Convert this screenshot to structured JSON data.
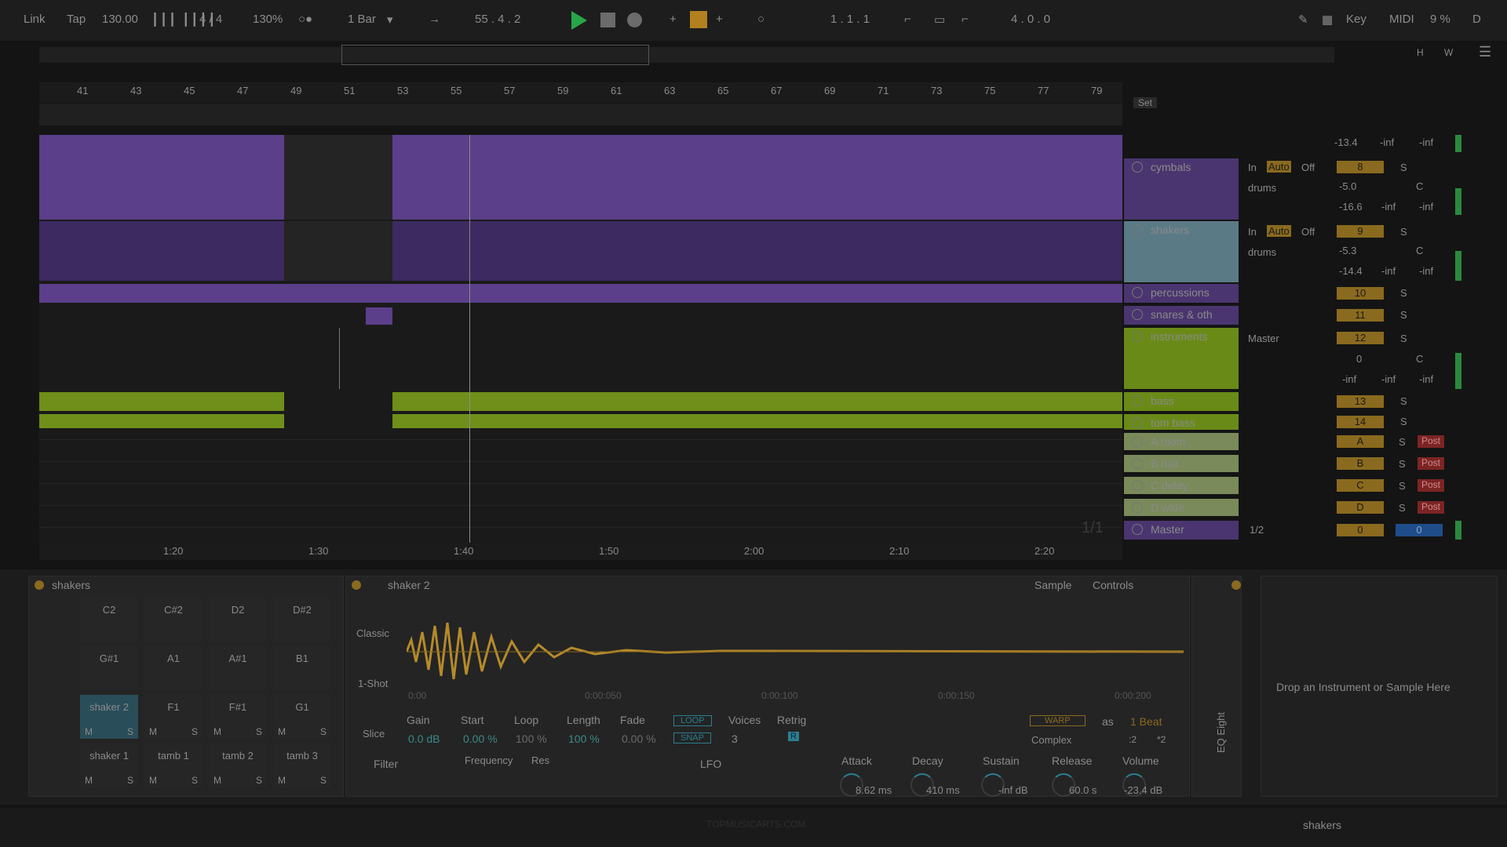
{
  "colors": {
    "purple": "#5b3f8a",
    "green": "#6f8f1a",
    "accent": "#b2801f",
    "play": "#28a64a"
  },
  "transport": {
    "link": "Link",
    "tap": "Tap",
    "tempo": "130.00",
    "signature": "4 / 4",
    "zoom": "130%",
    "quantize": "1 Bar",
    "position": "55 .  4 .  2",
    "loop_start": "1 .  1 .  1",
    "loop_length": "4 .  0 .  0",
    "key": "Key",
    "midi": "MIDI",
    "cpu": "9 %",
    "d": "D"
  },
  "ruler": [
    "41",
    "43",
    "45",
    "47",
    "49",
    "51",
    "53",
    "55",
    "57",
    "59",
    "61",
    "63",
    "65",
    "67",
    "69",
    "71",
    "73",
    "75",
    "77",
    "79"
  ],
  "timeline": [
    "1:20",
    "1:30",
    "1:40",
    "1:50",
    "2:00",
    "2:10",
    "2:20"
  ],
  "scroll_page": "1/1",
  "set_label": "Set",
  "tracks": [
    {
      "name": "cymbals",
      "in": "In",
      "auto": "Auto",
      "off": "Off",
      "num": "8",
      "route": "drums",
      "v1": "-5.0",
      "pan": "C",
      "v2": "-16.6",
      "v3": "-inf",
      "v4": "-inf"
    },
    {
      "name": "shakers",
      "in": "In",
      "auto": "Auto",
      "off": "Off",
      "num": "9",
      "route": "drums",
      "v1": "-5.3",
      "pan": "C",
      "v2": "-14.4",
      "v3": "-inf",
      "v4": "-inf"
    },
    {
      "name": "percussions",
      "num": "10"
    },
    {
      "name": "snares & oth",
      "num": "11"
    },
    {
      "name": "instruments",
      "num": "12",
      "route": "Master",
      "v1": "0",
      "pan": "C",
      "v2": "-inf",
      "v3": "-inf",
      "v4": "-inf"
    },
    {
      "name": "bass",
      "num": "13"
    },
    {
      "name": "tom bass",
      "num": "14"
    }
  ],
  "top_meter": {
    "v1": "-13.4",
    "v2": "-inf",
    "v3": "-inf"
  },
  "returns": [
    {
      "name": "A room",
      "letter": "A",
      "post": "Post"
    },
    {
      "name": "B hall",
      "letter": "B",
      "post": "Post"
    },
    {
      "name": "C delay",
      "letter": "C",
      "post": "Post"
    },
    {
      "name": "D wide",
      "letter": "D",
      "post": "Post"
    }
  ],
  "master": {
    "name": "Master",
    "route": "1/2",
    "v1": "0",
    "v2": "0"
  },
  "solo_label": "S",
  "drum_rack": {
    "title": "shakers",
    "rows": [
      [
        "C2",
        "C#2",
        "D2",
        "D#2"
      ],
      [
        "G#1",
        "A1",
        "A#1",
        "B1"
      ],
      [
        "shaker 2",
        "F1",
        "F#1",
        "G1"
      ],
      [
        "shaker 1",
        "tamb 1",
        "tamb 2",
        "tamb 3"
      ]
    ],
    "mute": "M",
    "solo": "S"
  },
  "simpler": {
    "title": "shaker 2",
    "tab_sample": "Sample",
    "tab_controls": "Controls",
    "modes": [
      "Classic",
      "1-Shot",
      "Slice"
    ],
    "time_marks": [
      "0:00",
      "0:00:050",
      "0:00:100",
      "0:00:150",
      "0:00:200"
    ],
    "gain": {
      "label": "Gain",
      "value": "0.0 dB"
    },
    "start": {
      "label": "Start",
      "value": "0.00 %"
    },
    "loop": {
      "label": "Loop",
      "value": "100 %"
    },
    "length": {
      "label": "Length",
      "value": "100 %"
    },
    "fade": {
      "label": "Fade",
      "value": "0.00 %"
    },
    "loop_btn": "LOOP",
    "snap_btn": "SNAP",
    "voices": {
      "label": "Voices",
      "value": "3"
    },
    "retrig": {
      "label": "Retrig",
      "value": "R"
    },
    "warp": "WARP",
    "as": "as",
    "beat": "1 Beat",
    "complex": "Complex",
    "half": ":2",
    "double": "*2",
    "filter": "Filter",
    "frequency": "Frequency",
    "res": "Res",
    "lfo": "LFO",
    "attack": {
      "label": "Attack",
      "value": "8.62 ms"
    },
    "decay": {
      "label": "Decay",
      "value": "410 ms"
    },
    "sustain": {
      "label": "Sustain",
      "value": "-inf dB"
    },
    "release": {
      "label": "Release",
      "value": "60.0 s"
    },
    "volume": {
      "label": "Volume",
      "value": "-23.4 dB"
    }
  },
  "eq_label": "EQ Eight",
  "drop_hint": "Drop an Instrument or Sample Here",
  "status_track": "shakers",
  "watermark": "TOPMUSICARTS.COM"
}
